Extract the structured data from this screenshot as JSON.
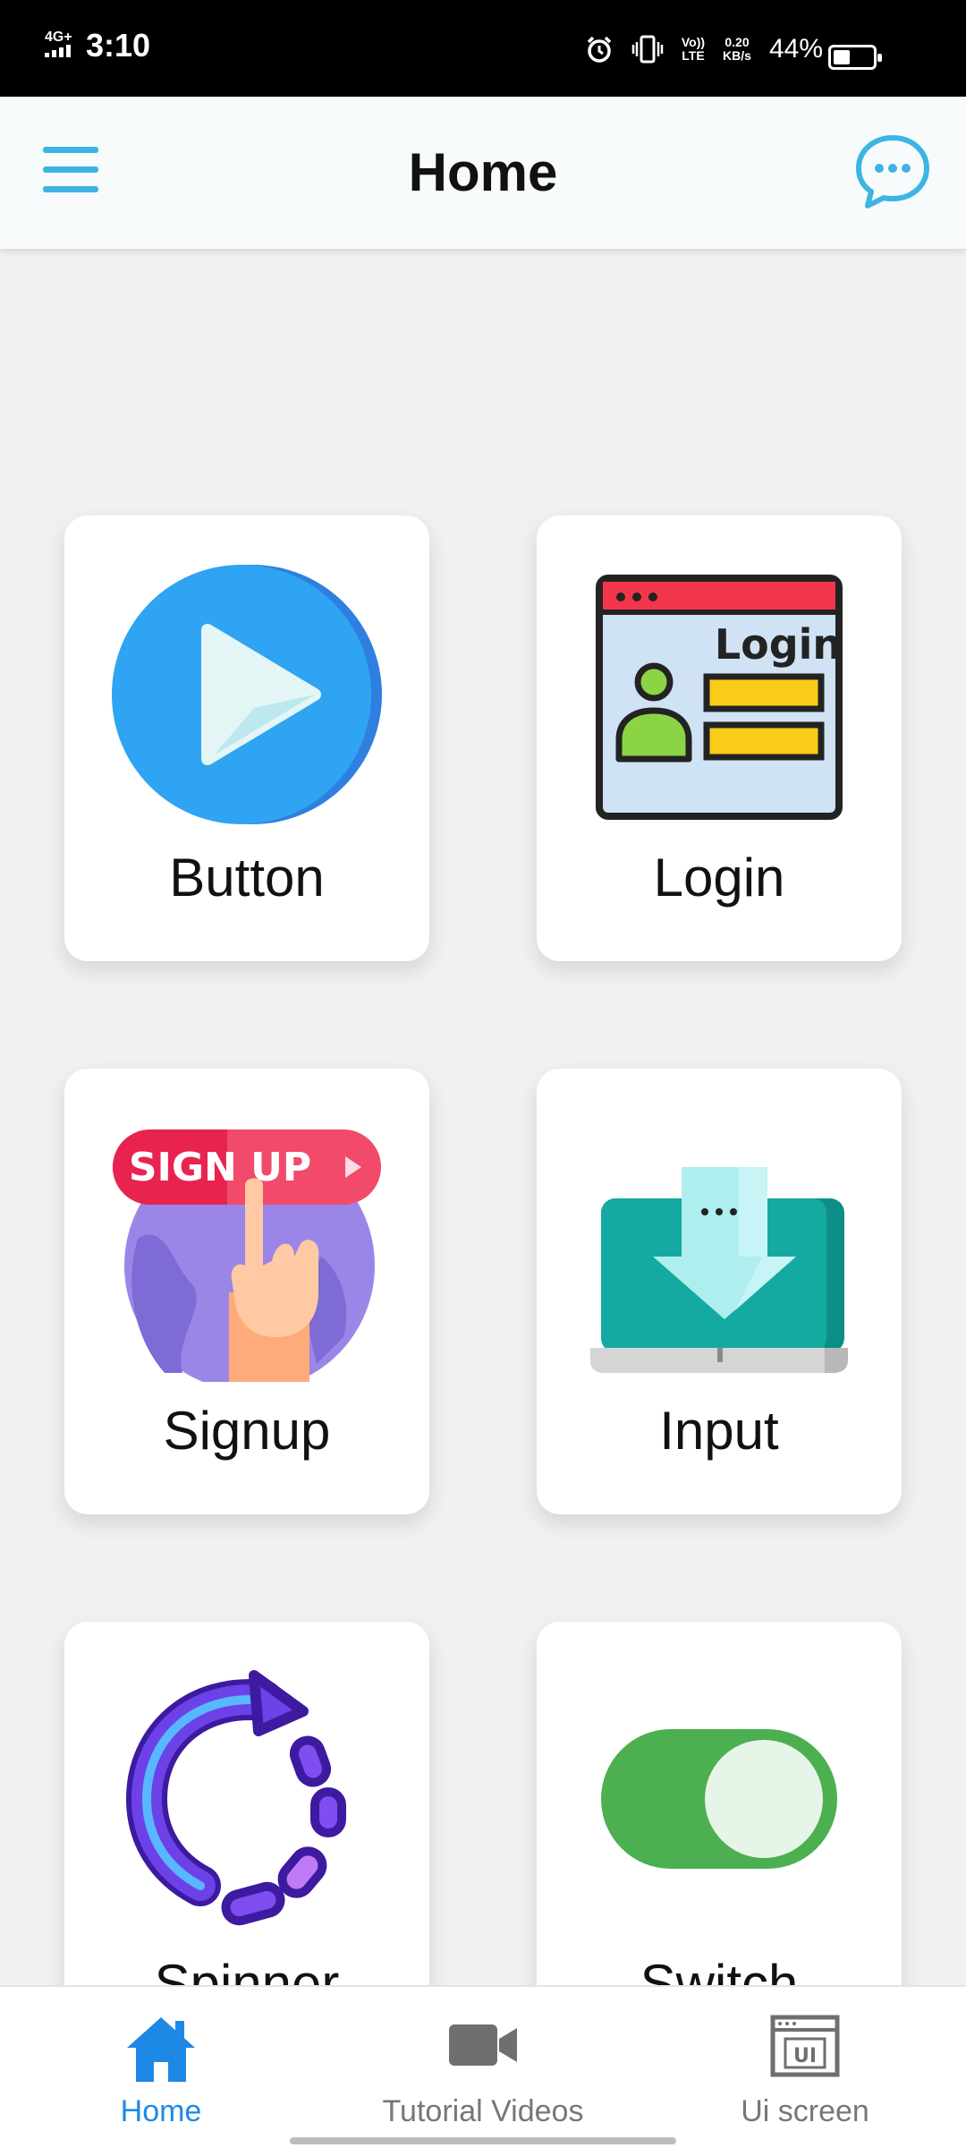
{
  "status_bar": {
    "network": "4G+",
    "time": "3:10",
    "volte_top": "Vo))",
    "volte_bottom": "LTE",
    "speed_value": "0.20",
    "speed_unit": "KB/s",
    "battery": "44%",
    "battery_level": 0.44
  },
  "header": {
    "title": "Home",
    "menu_icon": "hamburger-menu-icon",
    "chat_icon": "chat-bubble-icon"
  },
  "cards": [
    {
      "label": "Button",
      "icon": "play-icon"
    },
    {
      "label": "Login",
      "icon": "login-form-icon",
      "icon_text": "Login"
    },
    {
      "label": "Signup",
      "icon": "signup-icon",
      "icon_text": "SIGN UP"
    },
    {
      "label": "Input",
      "icon": "laptop-download-icon"
    },
    {
      "label": "Spinner",
      "icon": "spinner-icon"
    },
    {
      "label": "Switch",
      "icon": "toggle-switch-icon"
    }
  ],
  "bottom_nav": {
    "items": [
      {
        "label": "Home",
        "icon": "home-icon",
        "active": true
      },
      {
        "label": "Tutorial Videos",
        "icon": "video-camera-icon",
        "active": false
      },
      {
        "label": "Ui screen",
        "icon": "ui-window-icon",
        "active": false,
        "icon_text": "UI"
      }
    ]
  },
  "colors": {
    "accent": "#3cb5e5",
    "nav_active": "#1e88e5",
    "background": "#f1f1f1"
  }
}
